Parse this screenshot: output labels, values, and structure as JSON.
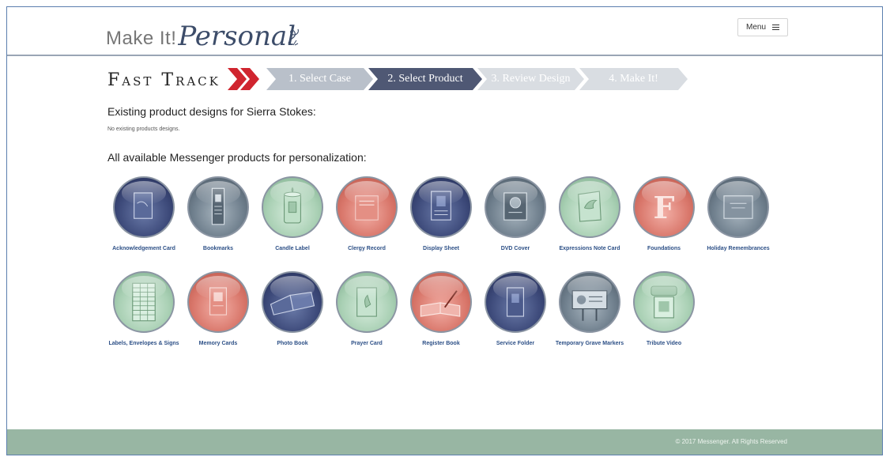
{
  "header": {
    "logo_make": "Make It!",
    "logo_personal": "Personal",
    "menu_label": "Menu"
  },
  "fast_track": {
    "title": "Fast Track",
    "steps": [
      {
        "label": "1. Select Case",
        "state": "done"
      },
      {
        "label": "2. Select Product",
        "state": "active"
      },
      {
        "label": "3. Review Design",
        "state": "pending"
      },
      {
        "label": "4. Make It!",
        "state": "pending"
      }
    ]
  },
  "existing": {
    "heading": "Existing product designs for Sierra Stokes:",
    "empty_text": "No existing products designs."
  },
  "available": {
    "heading": "All available Messenger products for personalization:",
    "products": [
      {
        "label": "Acknowledgement Card",
        "icon": "card-icon",
        "color": "navy"
      },
      {
        "label": "Bookmarks",
        "icon": "bookmark-icon",
        "color": "slate"
      },
      {
        "label": "Candle Label",
        "icon": "candle-icon",
        "color": "green"
      },
      {
        "label": "Clergy Record",
        "icon": "record-icon",
        "color": "red"
      },
      {
        "label": "Display Sheet",
        "icon": "display-sheet-icon",
        "color": "navy"
      },
      {
        "label": "DVD Cover",
        "icon": "dvd-cover-icon",
        "color": "slate"
      },
      {
        "label": "Expressions Note Card",
        "icon": "dove-card-icon",
        "color": "green"
      },
      {
        "label": "Foundations",
        "icon": "letter-f-icon",
        "color": "red"
      },
      {
        "label": "Holiday Remembrances",
        "icon": "holiday-card-icon",
        "color": "slate"
      },
      {
        "label": "Labels, Envelopes & Signs",
        "icon": "labels-sheet-icon",
        "color": "green"
      },
      {
        "label": "Memory Cards",
        "icon": "memory-card-icon",
        "color": "red"
      },
      {
        "label": "Photo Book",
        "icon": "photo-book-icon",
        "color": "navy"
      },
      {
        "label": "Prayer Card",
        "icon": "prayer-card-icon",
        "color": "green"
      },
      {
        "label": "Register Book",
        "icon": "register-book-icon",
        "color": "red"
      },
      {
        "label": "Service Folder",
        "icon": "folder-icon",
        "color": "navy"
      },
      {
        "label": "Temporary Grave Markers",
        "icon": "grave-marker-icon",
        "color": "slate"
      },
      {
        "label": "Tribute Video",
        "icon": "video-icon",
        "color": "green"
      }
    ]
  },
  "footer": {
    "copyright": "© 2017 Messenger. All Rights Reserved"
  },
  "colors": {
    "navy": "#3d4a7a",
    "slate": "#6f7f8d",
    "green": "#a9d0b4",
    "red": "#d9776b",
    "step_active": "#4f5874",
    "chevron_red": "#d0252f",
    "footer": "#98b6a3",
    "label_blue": "#2c4f86"
  }
}
